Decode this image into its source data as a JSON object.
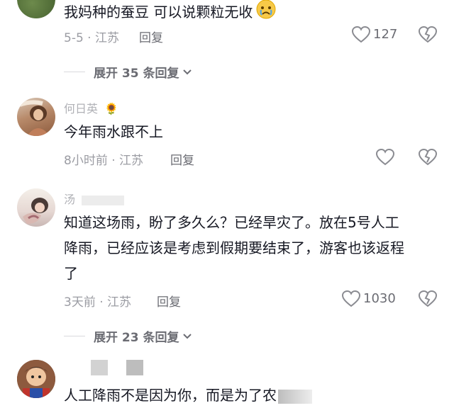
{
  "comments": [
    {
      "name": "",
      "text": "我妈种的蚕豆 可以说颗粒无收",
      "emoji_icon": "crying-face-icon",
      "meta": "5-5 · 江苏",
      "reply_label": "回复",
      "likes": "127",
      "expand_label": "展开 35 条回复"
    },
    {
      "name": "何日英",
      "name_emoji": "🌻",
      "text": "今年雨水跟不上",
      "meta": "8小时前 · 江苏",
      "reply_label": "回复",
      "likes": ""
    },
    {
      "name": "汤",
      "text_lines": [
        "知道这场雨，盼了多久么？已经旱灾了。放在5号人工",
        "降雨，已经应该是考虑到假期要结束了，游客也该返程",
        "了"
      ],
      "meta": "3天前 · 江苏",
      "reply_label": "回复",
      "likes": "1030",
      "expand_label": "展开 23 条回复"
    },
    {
      "name": "",
      "text": "人工降雨不是因为你，而是为了农"
    }
  ],
  "colors": {
    "text": "#161823",
    "muted": "#9b9ca3",
    "secondary": "#6b6c73"
  }
}
